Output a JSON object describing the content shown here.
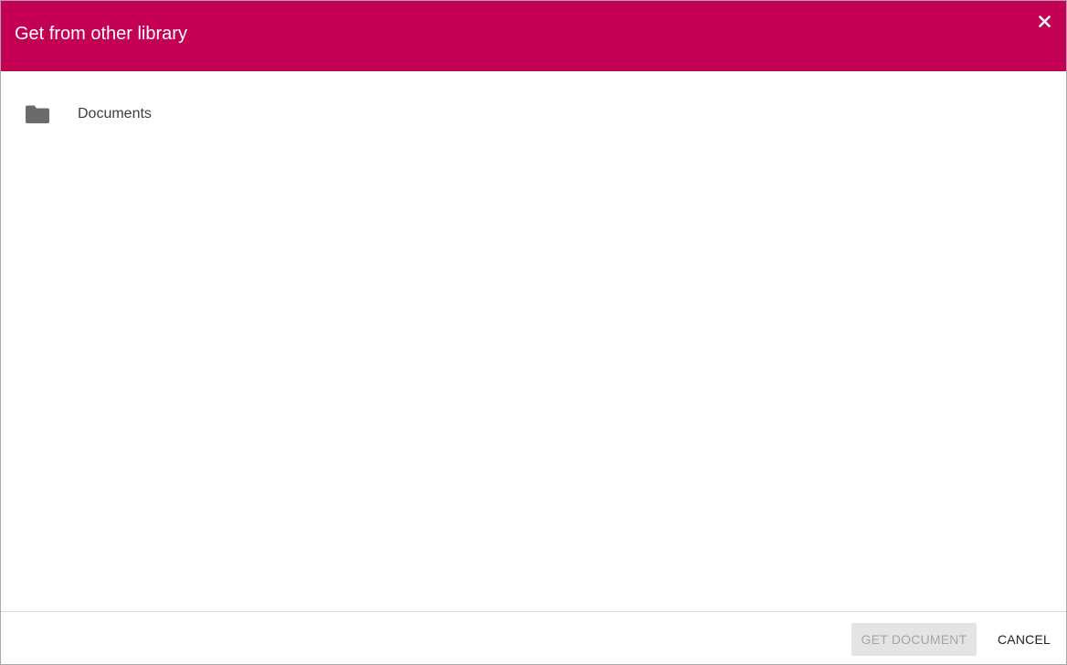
{
  "dialog": {
    "title": "Get from other library",
    "close_icon": "close-icon",
    "accent_color": "#c40055"
  },
  "content": {
    "items": [
      {
        "label": "Documents",
        "icon": "folder-icon"
      }
    ]
  },
  "footer": {
    "get_document_label": "GET DOCUMENT",
    "get_document_disabled": true,
    "cancel_label": "CANCEL"
  }
}
